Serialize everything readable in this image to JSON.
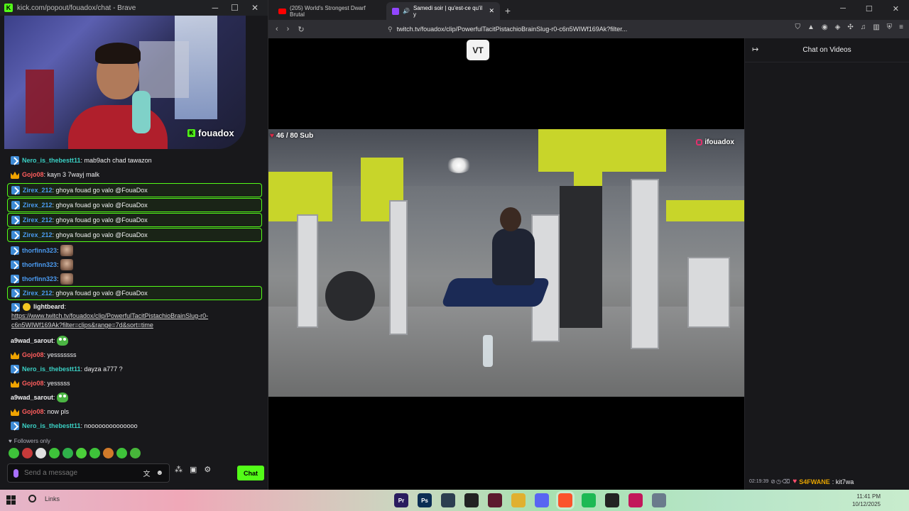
{
  "kick": {
    "window_title": "kick.com/popout/fouadox/chat - Brave",
    "streamer_name": "fouadox",
    "messages": [
      {
        "user": "Nero_is_thebestt11",
        "text": ": mab9ach chad tawazon",
        "badge": "sub-icon",
        "color": "cyan",
        "highlight": false
      },
      {
        "user": "Gojo08",
        "text": ": kayn 3 7wayj malk",
        "badge": "crown-icon",
        "color": "red",
        "highlight": false
      },
      {
        "user": "Zirex_212",
        "text": ": ghoya fouad go valo @FouaDox",
        "badge": "sub-icon",
        "color": "blue",
        "highlight": true
      },
      {
        "user": "Zirex_212",
        "text": ": ghoya fouad go valo @FouaDox",
        "badge": "sub-icon",
        "color": "blue",
        "highlight": true
      },
      {
        "user": "Zirex_212",
        "text": ": ghoya fouad go valo @FouaDox",
        "badge": "sub-icon",
        "color": "blue",
        "highlight": true
      },
      {
        "user": "Zirex_212",
        "text": ": ghoya fouad go valo @FouaDox",
        "badge": "sub-icon",
        "color": "blue",
        "highlight": true
      },
      {
        "user": "thorfinn323",
        "text": ":",
        "badge": "sub-icon",
        "color": "blue",
        "highlight": false,
        "emote": "face"
      },
      {
        "user": "thorfinn323",
        "text": ":",
        "badge": "sub-icon",
        "color": "blue",
        "highlight": false,
        "emote": "face"
      },
      {
        "user": "thorfinn323",
        "text": ":",
        "badge": "sub-icon",
        "color": "blue",
        "highlight": false,
        "emote": "face"
      },
      {
        "user": "Zirex_212",
        "text": ": ghoya fouad go valo @FouaDox",
        "badge": "sub-icon",
        "color": "blue",
        "highlight": true
      },
      {
        "user": "a9wad_sarout",
        "text": ":",
        "badge": "",
        "color": "white",
        "highlight": false,
        "emote": "pepe"
      },
      {
        "user": "Gojo08",
        "text": ": yesssssss",
        "badge": "crown-icon",
        "color": "red",
        "highlight": false
      },
      {
        "user": "Nero_is_thebestt11",
        "text": ": dayza a777 ?",
        "badge": "sub-icon",
        "color": "cyan",
        "highlight": false
      },
      {
        "user": "Gojo08",
        "text": ": yesssss",
        "badge": "crown-icon",
        "color": "red",
        "highlight": false
      },
      {
        "user": "a9wad_sarout",
        "text": ":",
        "badge": "",
        "color": "white",
        "highlight": false,
        "emote": "pepe"
      },
      {
        "user": "Gojo08",
        "text": ": now pls",
        "badge": "crown-icon",
        "color": "red",
        "highlight": false
      },
      {
        "user": "Nero_is_thebestt11",
        "text": ": noooooooooooooo",
        "badge": "sub-icon",
        "color": "cyan",
        "highlight": false
      }
    ],
    "link_message": {
      "user": "lightbeard",
      "line1": "https://www.twitch.tv/fouadox/clip/PowerfulTacitPistachioBrainSlug-r0-",
      "line2": "c6n5WIWf169Ak?filter=clips&range=7d&sort=time"
    },
    "followers_only": "Followers only",
    "input_placeholder": "Send a message",
    "chat_button": "Chat"
  },
  "browser": {
    "tabs": [
      {
        "title": "(205) World's Strongest Dwarf Brutal",
        "icon": "youtube-icon",
        "active": false
      },
      {
        "title": "Samedi soir | qu'est-ce qu'il y",
        "icon": "twitch-icon",
        "active": true
      }
    ],
    "url": "twitch.tv/fouadox/clip/PowerfulTacitPistachioBrainSlug-r0-c6n5WIWf169Ak?filter...",
    "video_logo": "VT",
    "sub_goal": "46  / 80 Sub",
    "watermark": "ifouadox",
    "side_chat_title": "Chat on Videos",
    "side_chat_message": {
      "timestamp": "02:19:39",
      "user": "S4FWANE",
      "text": ": kit7wa"
    }
  },
  "taskbar": {
    "search_label": "Links",
    "clock_time": "11:41 PM",
    "clock_date": "10/12/2025",
    "apps": [
      {
        "label": "Pr",
        "color": "#2a1b5e"
      },
      {
        "label": "Ps",
        "color": "#0b2d54"
      },
      {
        "label": "",
        "color": "#2c3e50"
      },
      {
        "label": "",
        "color": "#222222"
      },
      {
        "label": "",
        "color": "#5c1a2e"
      },
      {
        "label": "",
        "color": "#e0b030"
      },
      {
        "label": "",
        "color": "#5865f2"
      },
      {
        "label": "",
        "color": "#fb542b"
      },
      {
        "label": "",
        "color": "#1db954"
      },
      {
        "label": "",
        "color": "#222222"
      },
      {
        "label": "",
        "color": "#c2185b"
      },
      {
        "label": "",
        "color": "#6a7b8c"
      }
    ]
  }
}
